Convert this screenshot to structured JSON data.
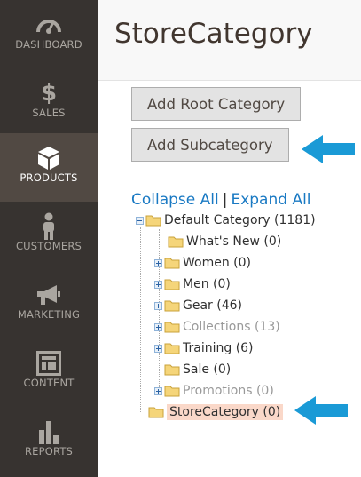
{
  "sidebar": {
    "items": [
      {
        "label": "DASHBOARD",
        "icon": "dashboard-icon"
      },
      {
        "label": "SALES",
        "icon": "dollar-icon"
      },
      {
        "label": "PRODUCTS",
        "icon": "box-icon",
        "active": true
      },
      {
        "label": "CUSTOMERS",
        "icon": "person-icon"
      },
      {
        "label": "MARKETING",
        "icon": "megaphone-icon"
      },
      {
        "label": "CONTENT",
        "icon": "layout-icon"
      },
      {
        "label": "REPORTS",
        "icon": "bar-chart-icon"
      }
    ]
  },
  "header": {
    "title": "StoreCategory"
  },
  "buttons": {
    "add_root": "Add Root Category",
    "add_sub": "Add Subcategory"
  },
  "tree_links": {
    "collapse": "Collapse All",
    "separator": "|",
    "expand": "Expand All"
  },
  "tree": [
    {
      "label": "Default Category (1181)",
      "expander": "minus",
      "muted": false
    },
    {
      "label": "What's New (0)",
      "expander": "none",
      "muted": false
    },
    {
      "label": "Women (0)",
      "expander": "plus",
      "muted": false
    },
    {
      "label": "Men (0)",
      "expander": "plus",
      "muted": false
    },
    {
      "label": "Gear (46)",
      "expander": "plus",
      "muted": false
    },
    {
      "label": "Collections (13)",
      "expander": "plus",
      "muted": true
    },
    {
      "label": "Training (6)",
      "expander": "plus",
      "muted": false
    },
    {
      "label": "Sale (0)",
      "expander": "none",
      "muted": false
    },
    {
      "label": "Promotions (0)",
      "expander": "plus",
      "muted": true
    },
    {
      "label": "StoreCategory (0)",
      "expander": "none",
      "selected": true
    }
  ],
  "colors": {
    "sidebar_bg": "#373330",
    "active_bg": "#514943",
    "link": "#1979c3",
    "arrow": "#1a9ad6",
    "selected": "#fad8c9"
  }
}
